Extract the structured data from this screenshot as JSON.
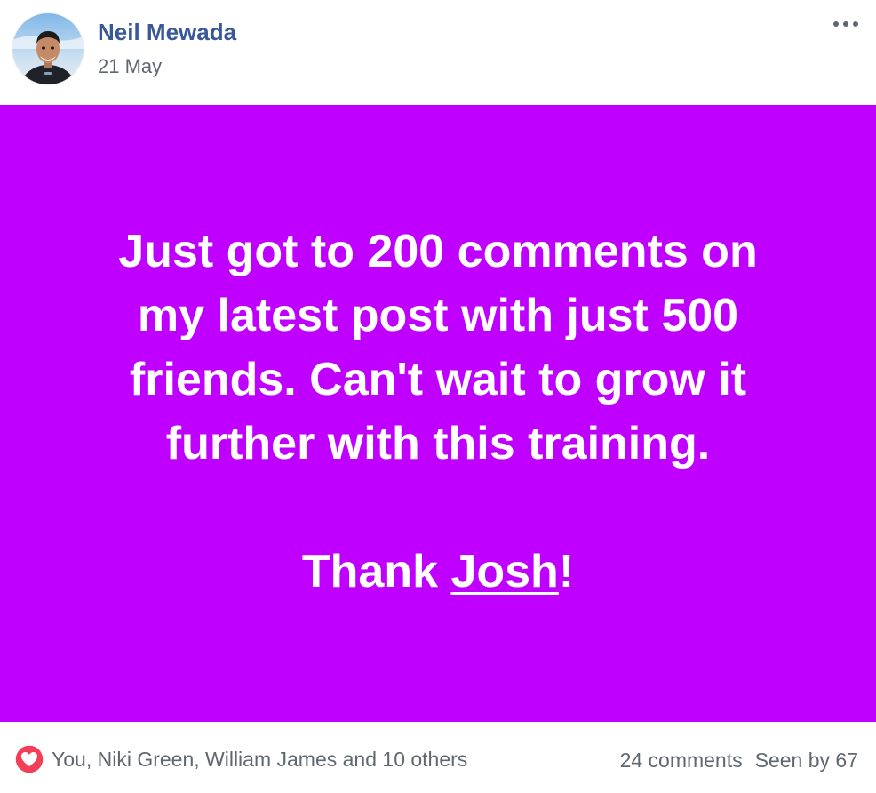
{
  "post": {
    "author": "Neil Mewada",
    "timestamp": "21 May",
    "background_color": "#C000FF",
    "text_lines": [
      "Just got to 200 comments on",
      "my latest post with just 500",
      "friends. Can't wait to grow it",
      "further with this training."
    ],
    "closing": {
      "prefix": "Thank ",
      "mention": "Josh",
      "suffix": "!"
    }
  },
  "footer": {
    "reaction_icon": "love-icon",
    "reactors": "You, Niki Green, William James and 10 others",
    "comments": "24 comments",
    "seen": "Seen by 67"
  },
  "icons": {
    "more": "more-options-icon",
    "avatar": "profile-avatar"
  },
  "colors": {
    "author_link": "#385898",
    "muted_text": "#606770",
    "love": "#F33E58"
  }
}
